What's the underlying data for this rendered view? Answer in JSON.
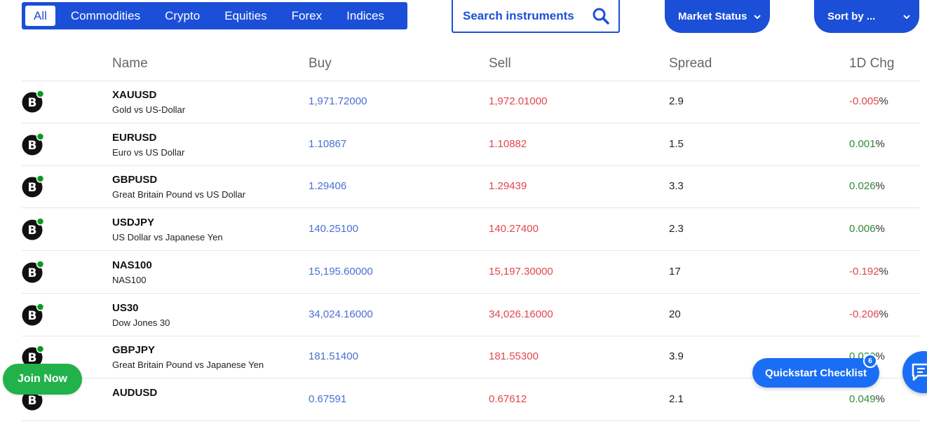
{
  "tabs": [
    {
      "label": "All",
      "active": true
    },
    {
      "label": "Commodities",
      "active": false
    },
    {
      "label": "Crypto",
      "active": false
    },
    {
      "label": "Equities",
      "active": false
    },
    {
      "label": "Forex",
      "active": false
    },
    {
      "label": "Indices",
      "active": false
    }
  ],
  "search": {
    "placeholder": "Search instruments",
    "icon": "search-icon"
  },
  "filters": {
    "market_status_label": "Market Status",
    "sort_label": "Sort by ..."
  },
  "table": {
    "headers": {
      "name": "Name",
      "buy": "Buy",
      "sell": "Sell",
      "spread": "Spread",
      "change": "1D Chg"
    },
    "rows": [
      {
        "symbol": "XAUUSD",
        "description": "Gold vs US-Dollar",
        "buy": "1,971.72000",
        "sell": "1,972.01000",
        "spread": "2.9",
        "change": "-0.005",
        "direction": "neg"
      },
      {
        "symbol": "EURUSD",
        "description": "Euro vs US Dollar",
        "buy": "1.10867",
        "sell": "1.10882",
        "spread": "1.5",
        "change": "0.001",
        "direction": "pos"
      },
      {
        "symbol": "GBPUSD",
        "description": "Great Britain Pound vs US Dollar",
        "buy": "1.29406",
        "sell": "1.29439",
        "spread": "3.3",
        "change": "0.026",
        "direction": "pos"
      },
      {
        "symbol": "USDJPY",
        "description": "US Dollar vs Japanese Yen",
        "buy": "140.25100",
        "sell": "140.27400",
        "spread": "2.3",
        "change": "0.006",
        "direction": "pos"
      },
      {
        "symbol": "NAS100",
        "description": "NAS100",
        "buy": "15,195.60000",
        "sell": "15,197.30000",
        "spread": "17",
        "change": "-0.192",
        "direction": "neg"
      },
      {
        "symbol": "US30",
        "description": "Dow Jones 30",
        "buy": "34,024.16000",
        "sell": "34,026.16000",
        "spread": "20",
        "change": "-0.206",
        "direction": "neg"
      },
      {
        "symbol": "GBPJPY",
        "description": "Great Britain Pound vs Japanese Yen",
        "buy": "181.51400",
        "sell": "181.55300",
        "spread": "3.9",
        "change": "0.020",
        "direction": "pos"
      },
      {
        "symbol": "AUDUSD",
        "description": "",
        "buy": "0.67591",
        "sell": "0.67612",
        "spread": "2.1",
        "change": "0.049",
        "direction": "pos"
      }
    ],
    "percent_sign": "%"
  },
  "join_button": {
    "label": "Join Now"
  },
  "quickstart": {
    "label": "Quickstart Checklist",
    "badge": "6"
  },
  "colors": {
    "brand": "#1c4fd8",
    "buy": "#4a6fd1",
    "sell": "#e0474c",
    "positive": "#2f8a3a",
    "join": "#21b24b",
    "online_dot": "#0a9a1e"
  }
}
